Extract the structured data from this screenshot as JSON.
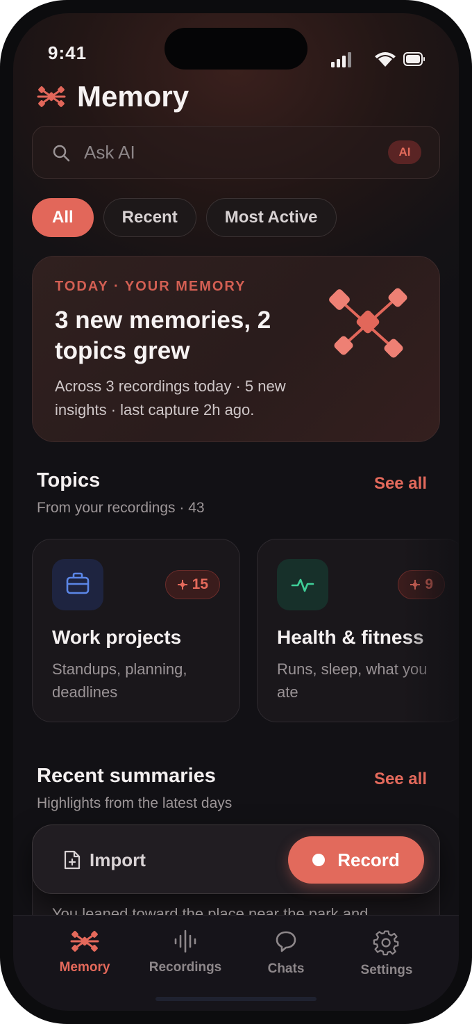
{
  "status": {
    "time": "9:41"
  },
  "app": {
    "title": "Memory"
  },
  "search": {
    "placeholder": "Ask AI",
    "badge": "AI"
  },
  "filters": [
    {
      "label": "All",
      "active": true
    },
    {
      "label": "Recent",
      "active": false
    },
    {
      "label": "Most Active",
      "active": false
    }
  ],
  "hero": {
    "kicker": "TODAY · YOUR MEMORY",
    "headline": "3 new memories, 2 topics grew",
    "subtitle": "Across 3 recordings today · 5 new insights · last capture 2h ago."
  },
  "topics_section": {
    "title": "Topics",
    "subtitle": "From your recordings · 43",
    "see_all": "See all",
    "items": [
      {
        "name": "Work projects",
        "description": "Standups, planning, deadlines",
        "count": "15",
        "icon": "briefcase-icon"
      },
      {
        "name": "Health & fitness",
        "description": "Runs, sleep, what you ate",
        "count": "9",
        "icon": "pulse-icon"
      }
    ]
  },
  "summaries_section": {
    "title": "Recent summaries",
    "subtitle": "Highlights from the latest days",
    "see_all": "See all",
    "preview_text": "You leaned toward the place near the park and"
  },
  "actions": {
    "import_label": "Import",
    "record_label": "Record"
  },
  "tabs": [
    {
      "label": "Memory",
      "icon": "memory-icon",
      "active": true
    },
    {
      "label": "Recordings",
      "icon": "waveform-icon",
      "active": false
    },
    {
      "label": "Chats",
      "icon": "chat-icon",
      "active": false
    },
    {
      "label": "Settings",
      "icon": "gear-icon",
      "active": false
    }
  ],
  "colors": {
    "accent": "#e2675a",
    "background": "#121115",
    "card": "#1a171b",
    "work_icon_bg": "#1e2440",
    "health_icon_bg": "#17302a"
  }
}
